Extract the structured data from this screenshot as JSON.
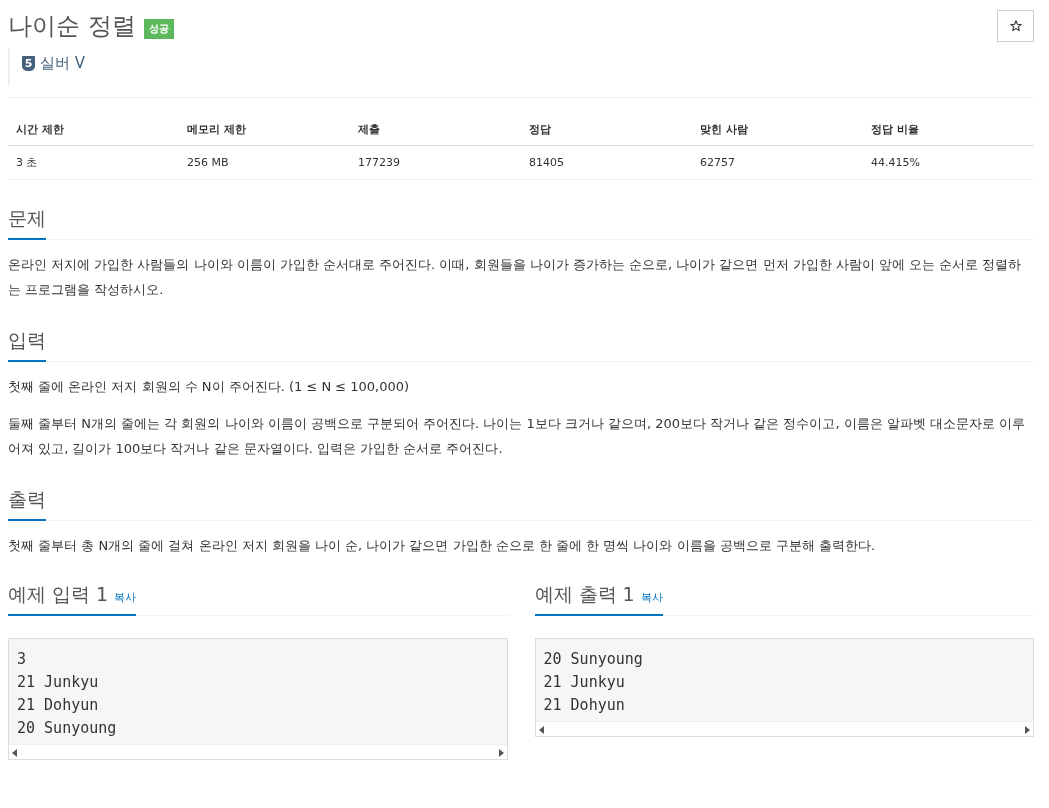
{
  "title": "나이순 정렬",
  "result_badge": "성공",
  "tier": {
    "level": "5",
    "label": "실버 V"
  },
  "stats": {
    "columns": [
      "시간 제한",
      "메모리 제한",
      "제출",
      "정답",
      "맞힌 사람",
      "정답 비율"
    ],
    "row": [
      "3 초",
      "256 MB",
      "177239",
      "81405",
      "62757",
      "44.415%"
    ]
  },
  "sections": [
    {
      "heading": "문제",
      "paragraphs": [
        "온라인 저지에 가입한 사람들의 나이와 이름이 가입한 순서대로 주어진다. 이때, 회원들을 나이가 증가하는 순으로, 나이가 같으면 먼저 가입한 사람이 앞에 오는 순서로 정렬하는 프로그램을 작성하시오."
      ]
    },
    {
      "heading": "입력",
      "paragraphs": [
        "첫째 줄에 온라인 저지 회원의 수 N이 주어진다. (1 ≤ N ≤ 100,000)",
        "둘째 줄부터 N개의 줄에는 각 회원의 나이와 이름이 공백으로 구분되어 주어진다. 나이는 1보다 크거나 같으며, 200보다 작거나 같은 정수이고, 이름은 알파벳 대소문자로 이루어져 있고, 길이가 100보다 작거나 같은 문자열이다. 입력은 가입한 순서로 주어진다."
      ]
    },
    {
      "heading": "출력",
      "paragraphs": [
        "첫째 줄부터 총 N개의 줄에 걸쳐 온라인 저지 회원을 나이 순, 나이가 같으면 가입한 순으로 한 줄에 한 명씩 나이와 이름을 공백으로 구분해 출력한다."
      ]
    }
  ],
  "samples": [
    {
      "title": "예제 입력 1",
      "copy": "복사",
      "lines": [
        "3",
        "21 Junkyu",
        "21 Dohyun",
        "20 Sunyoung"
      ]
    },
    {
      "title": "예제 출력 1",
      "copy": "복사",
      "lines": [
        "20 Sunyoung",
        "21 Junkyu",
        "21 Dohyun"
      ]
    }
  ]
}
